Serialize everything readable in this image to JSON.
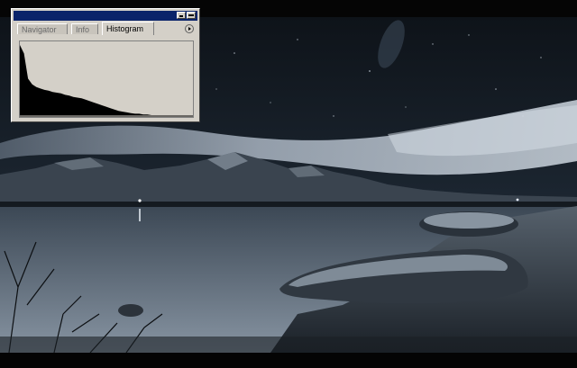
{
  "palette": {
    "tabs": [
      {
        "label": "Navigator",
        "active": false
      },
      {
        "label": "Info",
        "active": false
      },
      {
        "label": "Histogram",
        "active": true
      }
    ],
    "titlebar_color": "#0a246a",
    "histogram_levels": [
      100,
      88,
      52,
      44,
      40,
      38,
      36,
      35,
      33,
      32,
      31,
      29,
      28,
      26,
      25,
      24,
      22,
      20,
      18,
      16,
      14,
      12,
      10,
      8,
      6,
      5,
      4,
      3,
      2,
      2,
      1,
      1,
      0,
      0,
      0,
      0,
      0,
      0,
      0,
      0
    ]
  },
  "photo": {
    "subject": "night-landscape",
    "sky_color": "#1a2430",
    "cloud_color": "#9aa6b4",
    "water_color": "#4a5866"
  }
}
